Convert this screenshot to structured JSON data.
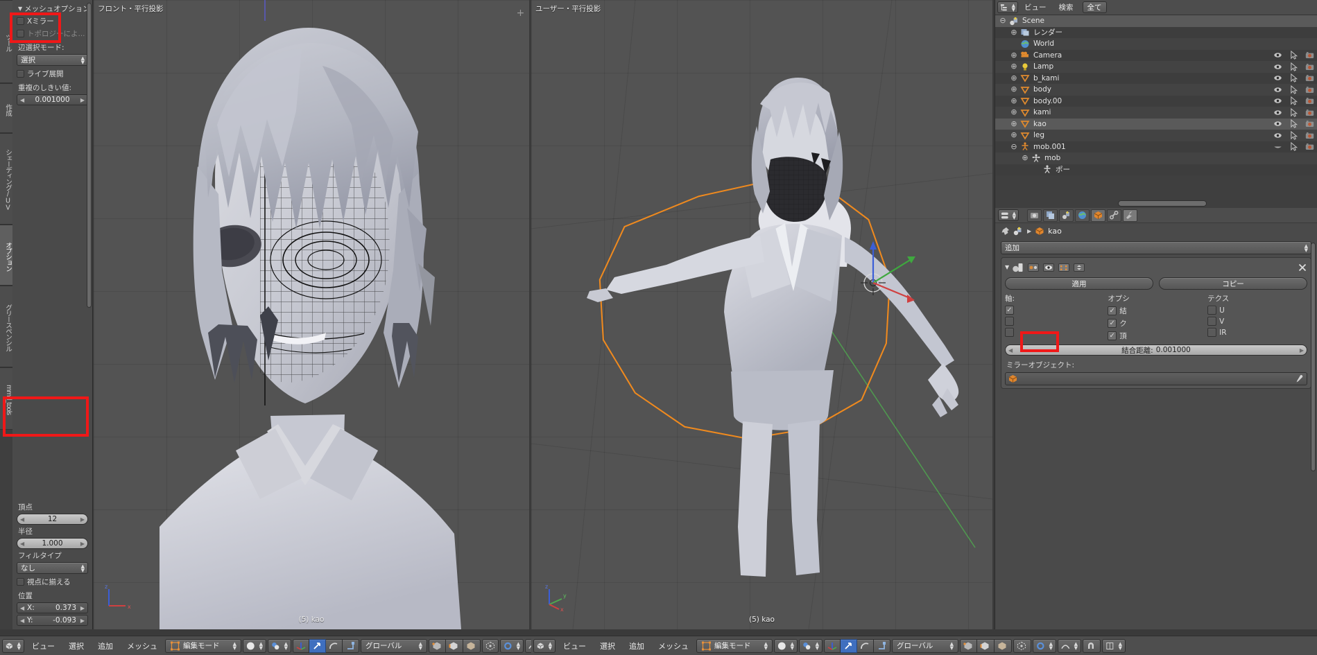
{
  "left_shelf": {
    "vtabs": [
      {
        "label": "ツール"
      },
      {
        "label": "作成"
      },
      {
        "label": "シェーディング/UV"
      },
      {
        "label": "オプション"
      },
      {
        "label": "グリースペンシル"
      },
      {
        "label": "mmd_tools"
      }
    ],
    "mesh_options": {
      "header": "メッシュオプション",
      "x_mirror_label": "Xミラー",
      "topology_label": "トポロジーによ...",
      "edge_select_mode_label": "辺選択モード:",
      "edge_select_mode_value": "選択",
      "live_unwrap_label": "ライブ展開",
      "threshold_label": "重複のしきい値:",
      "threshold_value": "0.001000"
    },
    "lower": {
      "vertices_label": "頂点",
      "vertices_value": "12",
      "radius_label": "半径",
      "radius_value": "1.000",
      "fill_type_label": "フィルタイプ",
      "fill_type_value": "なし",
      "align_view_label": "視点に揃える",
      "location_label": "位置",
      "x_label": "X:",
      "x_value": "0.373",
      "y_label": "Y:",
      "y_value": "-0.093"
    }
  },
  "viewport_left": {
    "header": "フロント・平行投影",
    "footer": "(5) kao",
    "axis_x": "x",
    "axis_z": "z"
  },
  "viewport_right": {
    "header": "ユーザー・平行投影",
    "footer": "(5) kao",
    "axis_x": "x",
    "axis_y": "y",
    "axis_z": "z"
  },
  "outliner": {
    "view_menu": "ビュー",
    "search_menu": "検索",
    "filter_button": "全て",
    "rows": [
      {
        "name": "Scene",
        "indent": 0,
        "expand": "⊖",
        "icon": "scene-icon",
        "selected": true,
        "has_vis": false
      },
      {
        "name": "レンダー",
        "indent": 1,
        "expand": "⊕",
        "icon": "render-icon",
        "selected": false,
        "has_vis": false
      },
      {
        "name": "World",
        "indent": 1,
        "expand": "",
        "icon": "world-icon",
        "selected": false,
        "has_vis": false
      },
      {
        "name": "Camera",
        "indent": 1,
        "expand": "⊕",
        "icon": "camera-icon",
        "selected": false,
        "has_vis": true
      },
      {
        "name": "Lamp",
        "indent": 1,
        "expand": "⊕",
        "icon": "lamp-icon",
        "selected": false,
        "has_vis": true
      },
      {
        "name": "b_kami",
        "indent": 1,
        "expand": "⊕",
        "icon": "mesh-icon",
        "selected": false,
        "has_vis": true
      },
      {
        "name": "body",
        "indent": 1,
        "expand": "⊕",
        "icon": "mesh-icon",
        "selected": false,
        "has_vis": true
      },
      {
        "name": "body.00",
        "indent": 1,
        "expand": "⊕",
        "icon": "mesh-icon",
        "selected": false,
        "has_vis": true
      },
      {
        "name": "kami",
        "indent": 1,
        "expand": "⊕",
        "icon": "mesh-icon",
        "selected": false,
        "has_vis": true
      },
      {
        "name": "kao",
        "indent": 1,
        "expand": "⊕",
        "icon": "mesh-icon",
        "selected": true,
        "has_vis": true
      },
      {
        "name": "leg",
        "indent": 1,
        "expand": "⊕",
        "icon": "mesh-icon",
        "selected": false,
        "has_vis": true
      },
      {
        "name": "mob.001",
        "indent": 1,
        "expand": "⊖",
        "icon": "armature-icon",
        "selected": false,
        "has_vis": true
      },
      {
        "name": "mob",
        "indent": 2,
        "expand": "⊕",
        "icon": "armature-data-icon",
        "selected": false,
        "has_vis": false
      },
      {
        "name": "ポー",
        "indent": 3,
        "expand": "",
        "icon": "pose-icon",
        "selected": false,
        "has_vis": false
      }
    ]
  },
  "properties": {
    "breadcrumb_object": "kao",
    "add_modifier_label": "追加",
    "modifier": {
      "apply_label": "適用",
      "copy_label": "コピー",
      "axis_col_label": "軸:",
      "options_col_label": "オプシ",
      "texture_col_label": "テクス",
      "axis_checks": [
        true,
        false,
        false
      ],
      "options": [
        {
          "label": "結",
          "checked": true
        },
        {
          "label": "ク",
          "checked": true
        },
        {
          "label": "頂",
          "checked": true
        }
      ],
      "texture": [
        {
          "label": "U",
          "checked": false
        },
        {
          "label": "V",
          "checked": false
        },
        {
          "label": "IR",
          "checked": false
        }
      ],
      "merge_limit_label": "結合距離:",
      "merge_limit_value": "0.001000",
      "mirror_object_label": "ミラーオブジェクト:"
    }
  },
  "bottom_bar_left": {
    "menus": [
      "ビュー",
      "選択",
      "追加",
      "メッシュ"
    ],
    "mode_value": "編集モード",
    "transform_orientation": "グローバル"
  },
  "bottom_bar_right": {
    "menus": [
      "ビュー",
      "選択",
      "追加",
      "メッシュ"
    ],
    "mode_value": "編集モード",
    "transform_orientation": "グローバル"
  },
  "colors": {
    "highlight_red": "#f01818",
    "accent_blue": "#3f6fbf",
    "mesh_orange": "#e8922e",
    "selection_orange": "#ff9a28"
  }
}
